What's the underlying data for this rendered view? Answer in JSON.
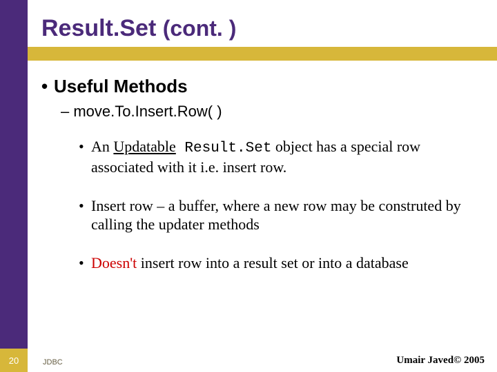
{
  "title": {
    "main": "Result.Set",
    "sub": "(cont. )"
  },
  "heading": "Useful Methods",
  "sub1_prefix": "– ",
  "sub1": "move.To.Insert.Row( )",
  "bullets": [
    {
      "pre": "An ",
      "underline": "Updatable",
      "mono": " Result.Set",
      "post": " object has a special row associated with it i.e. insert row."
    },
    {
      "text": "Insert row – a buffer, where a new row may be construted by calling the updater methods"
    },
    {
      "red": "Doesn't",
      "post": " insert row into a result set or into a database"
    }
  ],
  "footer": {
    "page": "20",
    "left": "JDBC",
    "right": "Umair Javed© 2005"
  }
}
